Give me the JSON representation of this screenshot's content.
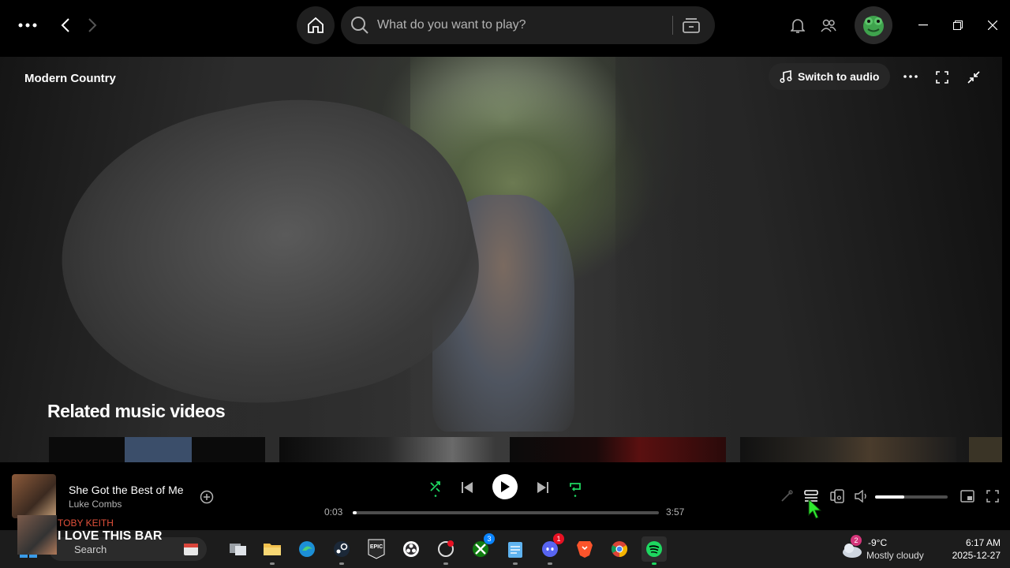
{
  "topbar": {
    "search_placeholder": "What do you want to play?"
  },
  "video": {
    "playlist_title": "Modern Country",
    "switch_audio_label": "Switch to audio",
    "related_title": "Related music videos"
  },
  "player": {
    "track_title": "She Got the Best of Me",
    "track_artist": "Luke Combs",
    "elapsed": "0:03",
    "duration": "3:57",
    "progress_fraction": 0.013,
    "volume_fraction": 0.4,
    "accent_color": "#1ed760"
  },
  "notification": {
    "artist": "TOBY KEITH",
    "song": "I LOVE THIS BAR"
  },
  "taskbar": {
    "search_label": "Search",
    "xbox_badge": "3",
    "discord_badge": "1",
    "weather_badge": "2",
    "weather_temp": "-9°C",
    "weather_desc": "Mostly cloudy",
    "time": "6:17 AM",
    "date": "2025-12-27"
  }
}
